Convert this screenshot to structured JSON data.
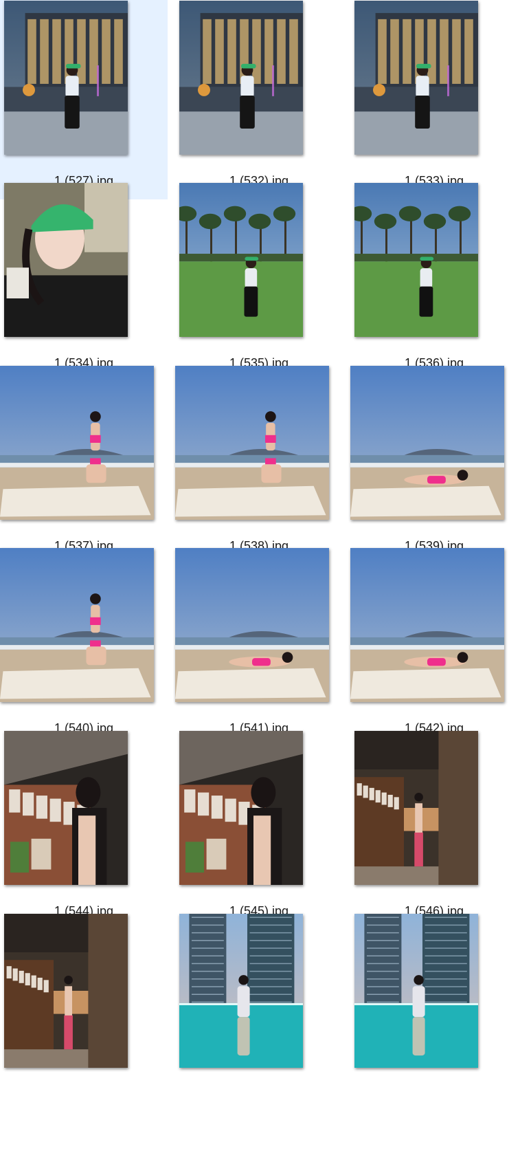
{
  "items": [
    {
      "name": "1 (527).jpg",
      "selected": true,
      "orientation": "portrait",
      "scene": "night"
    },
    {
      "name": "1 (532).jpg",
      "selected": false,
      "orientation": "portrait",
      "scene": "night"
    },
    {
      "name": "1 (533).jpg",
      "selected": false,
      "orientation": "portrait",
      "scene": "night"
    },
    {
      "name": "1 (534).jpg",
      "selected": false,
      "orientation": "portrait",
      "scene": "selfie"
    },
    {
      "name": "1 (535).jpg",
      "selected": false,
      "orientation": "portrait",
      "scene": "park"
    },
    {
      "name": "1 (536).jpg",
      "selected": false,
      "orientation": "portrait",
      "scene": "park"
    },
    {
      "name": "1 (537).jpg",
      "selected": false,
      "orientation": "landscape",
      "scene": "beach"
    },
    {
      "name": "1 (538).jpg",
      "selected": false,
      "orientation": "landscape",
      "scene": "beach"
    },
    {
      "name": "1 (539).jpg",
      "selected": false,
      "orientation": "landscape",
      "scene": "beach"
    },
    {
      "name": "1 (540).jpg",
      "selected": false,
      "orientation": "landscape",
      "scene": "beach"
    },
    {
      "name": "1 (541).jpg",
      "selected": false,
      "orientation": "landscape",
      "scene": "beach"
    },
    {
      "name": "1 (542).jpg",
      "selected": false,
      "orientation": "landscape",
      "scene": "beach"
    },
    {
      "name": "1 (544).jpg",
      "selected": false,
      "orientation": "portrait",
      "scene": "gallery"
    },
    {
      "name": "1 (545).jpg",
      "selected": false,
      "orientation": "portrait",
      "scene": "gallery"
    },
    {
      "name": "1 (546).jpg",
      "selected": false,
      "orientation": "portrait",
      "scene": "hall"
    },
    {
      "name": "",
      "selected": false,
      "orientation": "portrait",
      "scene": "hall"
    },
    {
      "name": "",
      "selected": false,
      "orientation": "portrait",
      "scene": "pool"
    },
    {
      "name": "",
      "selected": false,
      "orientation": "portrait",
      "scene": "pool"
    }
  ],
  "colors": {
    "selection": "#e5f1ff",
    "caption_text": "#1a1a1a"
  }
}
